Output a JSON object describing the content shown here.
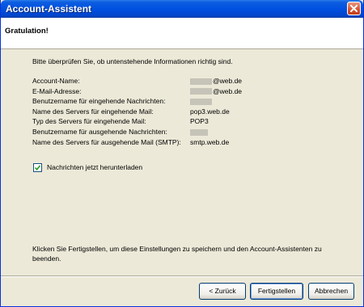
{
  "window": {
    "title": "Account-Assistent"
  },
  "header": {
    "title": "Gratulation!"
  },
  "intro_text": "Bitte überprüfen Sie, ob untenstehende Informationen richtig sind.",
  "summary": [
    {
      "label": "Account-Name:",
      "value": "@web.de",
      "redacted": true
    },
    {
      "label": "E-Mail-Adresse:",
      "value": "@web.de",
      "redacted": true
    },
    {
      "label": "Benutzername für eingehende Nachrichten:",
      "value": "",
      "redacted": true
    },
    {
      "label": "Name des Servers für eingehende Mail:",
      "value": "pop3.web.de",
      "redacted": false
    },
    {
      "label": "Typ des Servers für eingehende Mail:",
      "value": "POP3",
      "redacted": false
    },
    {
      "label": "Benutzername für ausgehende Nachrichten:",
      "value": "",
      "redacted": true
    },
    {
      "label": "Name des Servers für ausgehende Mail (SMTP):",
      "value": "smtp.web.de",
      "redacted": false
    }
  ],
  "download_checkbox": {
    "label": "Nachrichten jetzt herunterladen",
    "checked": true
  },
  "finish_text": "Klicken Sie Fertigstellen, um diese Einstellungen zu speichern und den Account-Assistenten zu beenden.",
  "buttons": {
    "back": "< Zurück",
    "finish": "Fertigstellen",
    "cancel": "Abbrechen"
  },
  "colors": {
    "titlebar": "#0050e0",
    "dialog_bg": "#ece9d8",
    "close_button": "#d5512d",
    "checkmark": "#21a121"
  }
}
